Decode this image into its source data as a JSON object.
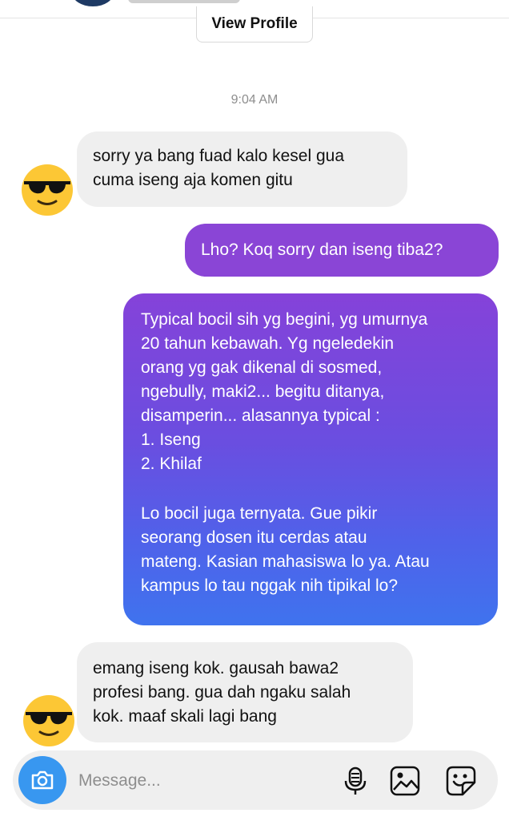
{
  "header": {
    "view_profile_label": "View Profile"
  },
  "conversation": {
    "timestamp": "9:04 AM",
    "messages": [
      {
        "side": "incoming",
        "lines": [
          "sorry ya bang fuad kalo kesel gua",
          "cuma iseng aja komen gitu"
        ]
      },
      {
        "side": "outgoing",
        "lines": [
          "Lho? Koq sorry dan iseng tiba2?"
        ]
      },
      {
        "side": "outgoing",
        "paragraphs": [
          [
            "Typical bocil sih yg begini, yg umurnya",
            "20 tahun kebawah. Yg ngeledekin",
            "orang yg gak dikenal di sosmed,",
            "ngebully, maki2... begitu ditanya,",
            "disamperin... alasannya typical :",
            "1. Iseng",
            "2. Khilaf"
          ],
          [
            "Lo bocil juga ternyata. Gue pikir",
            "seorang dosen itu cerdas atau",
            "mateng. Kasian mahasiswa lo ya. Atau",
            "kampus lo tau nggak nih tipikal lo?"
          ]
        ]
      },
      {
        "side": "incoming",
        "lines": [
          "emang iseng kok. gausah bawa2",
          "profesi bang. gua dah ngaku salah",
          "kok. maaf skali lagi bang"
        ]
      }
    ]
  },
  "avatar": {
    "icon": "sunglasses-emoji-icon"
  },
  "composer": {
    "placeholder": "Message...",
    "icons": [
      "camera-icon",
      "microphone-icon",
      "gallery-icon",
      "sticker-icon"
    ],
    "camera_color": "#3897f0"
  },
  "colors": {
    "incoming_bubble": "#efefef",
    "outgoing_start": "#8542d9",
    "outgoing_end": "#3f73ee"
  }
}
